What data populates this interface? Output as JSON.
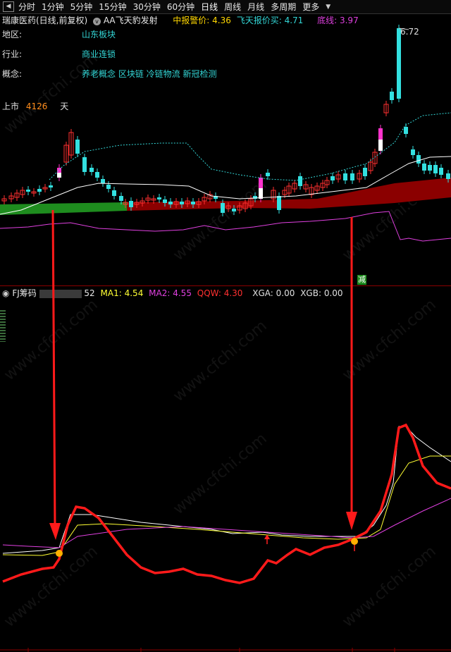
{
  "toolbar": {
    "tabs": [
      "分时",
      "1分钟",
      "5分钟",
      "15分钟",
      "30分钟",
      "60分钟",
      "日线",
      "周线",
      "月线",
      "多周期",
      "更多"
    ],
    "more_icon": "triangle-down"
  },
  "header": {
    "stock_name": "瑞康医药(日线,前复权)",
    "indicator_name": "AA飞天豹发射",
    "items": [
      {
        "label": "中报警价:",
        "value": "4.36",
        "label_color": "#ffd700",
        "value_color": "#ffd700"
      },
      {
        "label": "飞天报价买:",
        "value": "4.71",
        "label_color": "#33d6d6",
        "value_color": "#33d6d6"
      },
      {
        "label": "底线:",
        "value": "3.97",
        "label_color": "#e040e0",
        "value_color": "#e040e0"
      }
    ]
  },
  "info": {
    "region_label": "地区:",
    "region_value": "山东板块",
    "industry_label": "行业:",
    "industry_value": "商业连锁",
    "concept_label": "概念:",
    "concept_value": "养老概念 区块链 冷链物流 新冠检测",
    "listing_label": "上市",
    "listing_days": "4126",
    "listing_unit": "天"
  },
  "price_annotation": "6.72",
  "reduce_badge": "减",
  "indicator": {
    "name": "FJ筹码",
    "value_fragment": "52",
    "ma1_label": "MA1:",
    "ma1_value": "4.54",
    "ma2_label": "MA2:",
    "ma2_value": "4.55",
    "qqw_label": "QQW:",
    "qqw_value": "4.30",
    "xga_label": "XGA:",
    "xga_value": "0.00",
    "xgb_label": "XGB:",
    "xgb_value": "0.00"
  },
  "watermark": "www.cfchi.com",
  "colors": {
    "up": "#ff3030",
    "down": "#33e0e0",
    "ma_white": "#ffffff",
    "ma_yellow": "#ffff33",
    "ma_magenta": "#e040e0",
    "band_green": "#1e8c1e",
    "band_red": "#8b0000",
    "arrow_red": "#ff1a1a"
  }
}
